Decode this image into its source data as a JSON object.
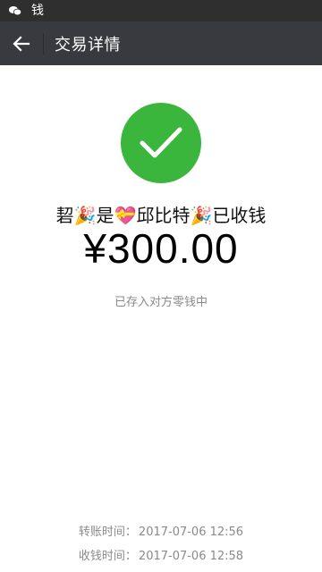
{
  "status_bar": {
    "app_icon": "wechat-icon",
    "title": "钱"
  },
  "header": {
    "back_icon": "back-arrow-icon",
    "title": "交易详情"
  },
  "status": {
    "icon": "check-icon",
    "color": "#3bb63d"
  },
  "payee": {
    "text": "䂮🎉是💝邱比特🎉已收钱"
  },
  "amount": "¥300.00",
  "note": "已存入对方零钱中",
  "details": [
    {
      "label": "转账时间：",
      "value": "2017-07-06 12:56"
    },
    {
      "label": "收钱时间：",
      "value": "2017-07-06 12:58"
    }
  ]
}
